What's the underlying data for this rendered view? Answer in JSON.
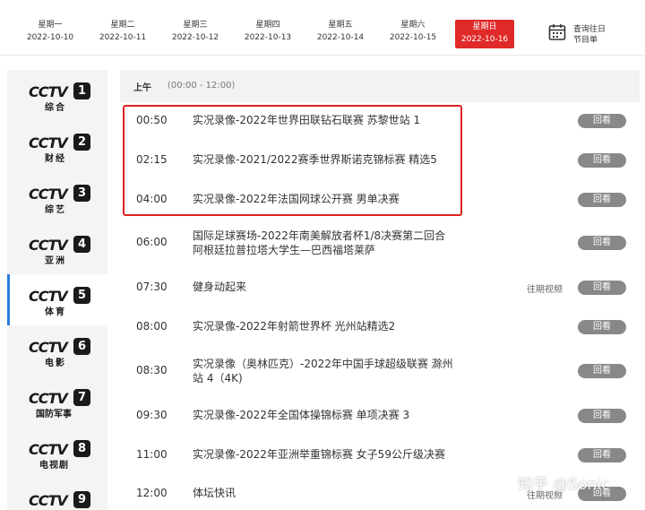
{
  "dates": [
    {
      "weekday": "星期一",
      "date": "2022-10-10",
      "active": false
    },
    {
      "weekday": "星期二",
      "date": "2022-10-11",
      "active": false
    },
    {
      "weekday": "星期三",
      "date": "2022-10-12",
      "active": false
    },
    {
      "weekday": "星期四",
      "date": "2022-10-13",
      "active": false
    },
    {
      "weekday": "星期五",
      "date": "2022-10-14",
      "active": false
    },
    {
      "weekday": "星期六",
      "date": "2022-10-15",
      "active": false
    },
    {
      "weekday": "星期日",
      "date": "2022-10-16",
      "active": true
    }
  ],
  "history": {
    "line1": "查询往日",
    "line2": "节目单",
    "icon": "calendar-icon"
  },
  "channels": [
    {
      "logo": "CCTV",
      "number": "1",
      "name": "综合",
      "active": false
    },
    {
      "logo": "CCTV",
      "number": "2",
      "name": "财经",
      "active": false
    },
    {
      "logo": "CCTV",
      "number": "3",
      "name": "综艺",
      "active": false
    },
    {
      "logo": "CCTV",
      "number": "4",
      "name": "亚洲",
      "active": false
    },
    {
      "logo": "CCTV",
      "number": "5",
      "name": "体育",
      "active": true
    },
    {
      "logo": "CCTV",
      "number": "6",
      "name": "电影",
      "active": false
    },
    {
      "logo": "CCTV",
      "number": "7",
      "name": "国防军事",
      "active": false
    },
    {
      "logo": "CCTV",
      "number": "8",
      "name": "电视剧",
      "active": false
    },
    {
      "logo": "CCTV",
      "number": "9",
      "name": "",
      "active": false
    }
  ],
  "segment": {
    "label": "上午",
    "range": "(00:00 - 12:00)"
  },
  "programs": [
    {
      "time": "00:50",
      "title": "实况录像-2022年世界田联钻石联赛 苏黎世站 1",
      "archive": "",
      "button": "回看"
    },
    {
      "time": "02:15",
      "title": "实况录像-2021/2022赛季世界斯诺克锦标赛 精选5",
      "archive": "",
      "button": "回看"
    },
    {
      "time": "04:00",
      "title": "实况录像-2022年法国网球公开赛 男单决赛",
      "archive": "",
      "button": "回看"
    },
    {
      "time": "06:00",
      "title": "国际足球赛场-2022年南美解放者杯1/8决赛第二回合 阿根廷拉普拉塔大学生—巴西福塔莱萨",
      "archive": "",
      "button": "回看"
    },
    {
      "time": "07:30",
      "title": "健身动起来",
      "archive": "往期视频",
      "button": "回看"
    },
    {
      "time": "08:00",
      "title": "实况录像-2022年射箭世界杯 光州站精选2",
      "archive": "",
      "button": "回看"
    },
    {
      "time": "08:30",
      "title": "实况录像（奥林匹克）-2022年中国手球超级联赛 滁州站 4（4K)",
      "archive": "",
      "button": "回看"
    },
    {
      "time": "09:30",
      "title": "实况录像-2022年全国体操锦标赛 单项决赛 3",
      "archive": "",
      "button": "回看"
    },
    {
      "time": "11:00",
      "title": "实况录像-2022年亚洲举重锦标赛 女子59公斤级决赛",
      "archive": "",
      "button": "回看"
    },
    {
      "time": "12:00",
      "title": "体坛快讯",
      "archive": "往期视频",
      "button": "回看"
    }
  ],
  "watermark": "知乎 @Sonic",
  "colors": {
    "accent": "#e02a2a",
    "button": "#888888",
    "highlight": "#e02020",
    "active_channel": "#2a7de1"
  }
}
